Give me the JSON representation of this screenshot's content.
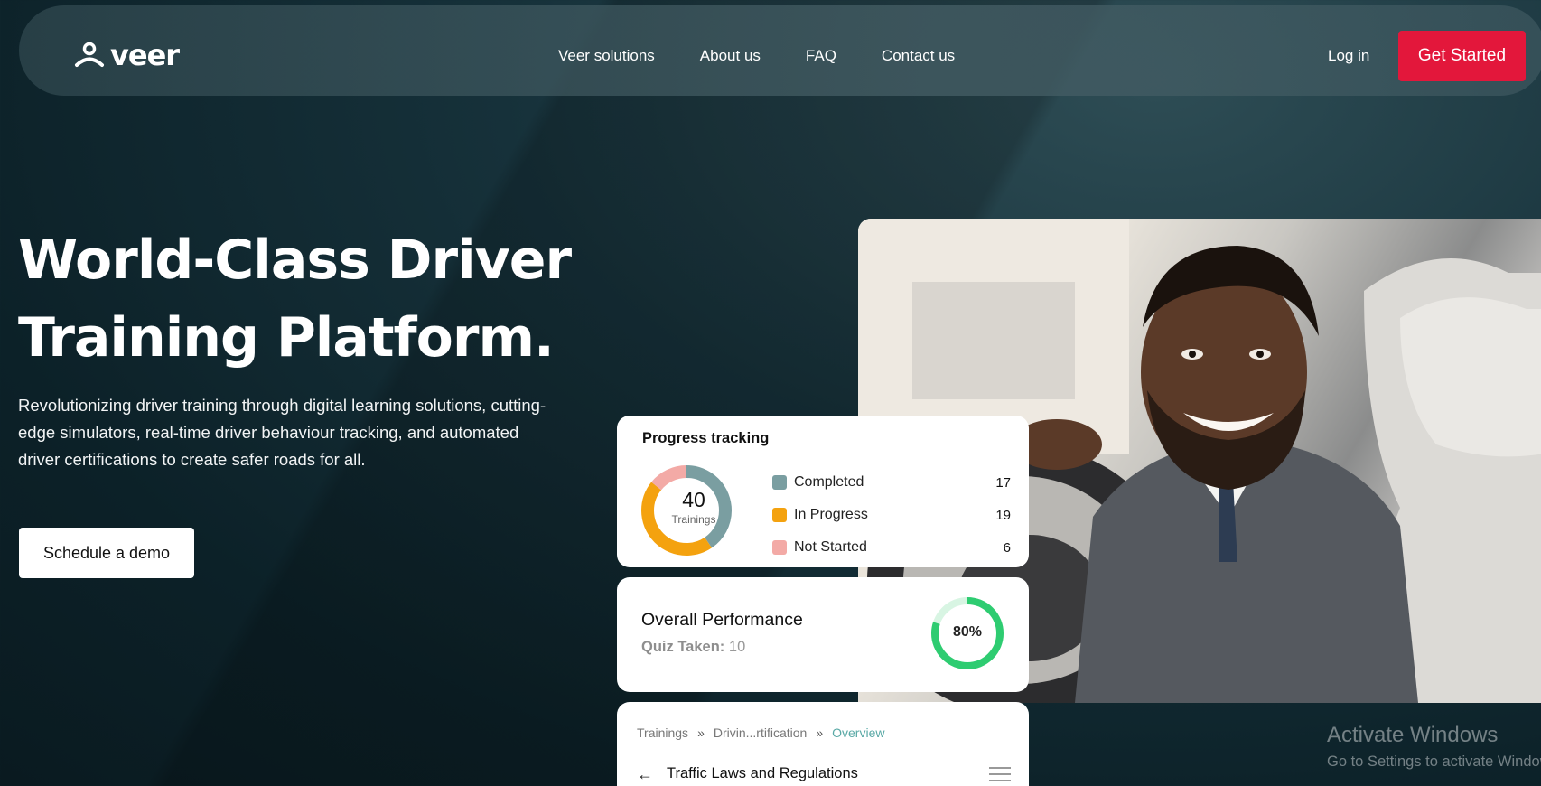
{
  "nav": {
    "brand": "veer",
    "links": [
      "Veer solutions",
      "About us",
      "FAQ",
      "Contact us"
    ],
    "login": "Log in",
    "cta": "Get Started"
  },
  "hero": {
    "title_line1": "World-Class Driver",
    "title_line2": "Training Platform.",
    "subtitle": "Revolutionizing driver training through digital learning solutions, cutting-edge simulators, real-time driver behaviour tracking, and automated driver certifications to create safer roads for all.",
    "demo_button": "Schedule a demo"
  },
  "progress": {
    "title": "Progress tracking",
    "total": "40",
    "total_label": "Trainings",
    "items": [
      {
        "label": "Completed",
        "value": "17",
        "color": "#7a9ea1"
      },
      {
        "label": "In Progress",
        "value": "19",
        "color": "#f4a20f"
      },
      {
        "label": "Not Started",
        "value": "6",
        "color": "#f3aaa6"
      }
    ]
  },
  "performance": {
    "title": "Overall Performance",
    "quiz_label": "Quiz Taken:",
    "quiz_value": "10",
    "percent": "80%",
    "percent_value": 0.8,
    "ring_color": "#2ecc71",
    "ring_track": "#d8f5e3"
  },
  "training": {
    "breadcrumb": [
      "Trainings",
      "Drivin...rtification",
      "Overview"
    ],
    "title": "Traffic Laws and Regulations"
  },
  "watermark": {
    "line1": "Activate Windows",
    "line2": "Go to Settings to activate Windows."
  },
  "colors": {
    "accent": "#e3173b",
    "background": "#0f262d"
  }
}
